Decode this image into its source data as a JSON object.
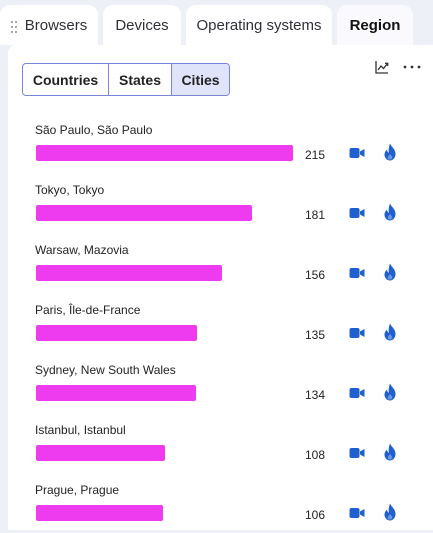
{
  "tabs": [
    {
      "label": "Browsers",
      "active": false
    },
    {
      "label": "Devices",
      "active": false
    },
    {
      "label": "Operating systems",
      "active": false
    },
    {
      "label": "Region",
      "active": true
    }
  ],
  "segments": [
    {
      "label": "Countries",
      "active": false
    },
    {
      "label": "States",
      "active": false
    },
    {
      "label": "Cities",
      "active": true
    }
  ],
  "toolbar": {
    "chart_icon": "line-chart-icon",
    "more_icon": "more-horizontal-icon"
  },
  "colors": {
    "bar": "#ee3bf0",
    "accent_icon": "#1f5fd0",
    "segment_active": "#dfe4fb"
  },
  "chart_data": {
    "type": "bar",
    "categories": [
      "São Paulo, São Paulo",
      "Tokyo, Tokyo",
      "Warsaw, Mazovia",
      "Paris, Île-de-France",
      "Sydney, New South Wales",
      "Istanbul, Istanbul",
      "Prague, Prague"
    ],
    "values": [
      215,
      181,
      156,
      135,
      134,
      108,
      106
    ]
  },
  "rows": [
    {
      "label": "São Paulo, São Paulo",
      "count": "215"
    },
    {
      "label": "Tokyo, Tokyo",
      "count": "181"
    },
    {
      "label": "Warsaw, Mazovia",
      "count": "156"
    },
    {
      "label": "Paris, Île-de-France",
      "count": "135"
    },
    {
      "label": "Sydney, New South Wales",
      "count": "134"
    },
    {
      "label": "Istanbul, Istanbul",
      "count": "108"
    },
    {
      "label": "Prague, Prague",
      "count": "106"
    }
  ]
}
